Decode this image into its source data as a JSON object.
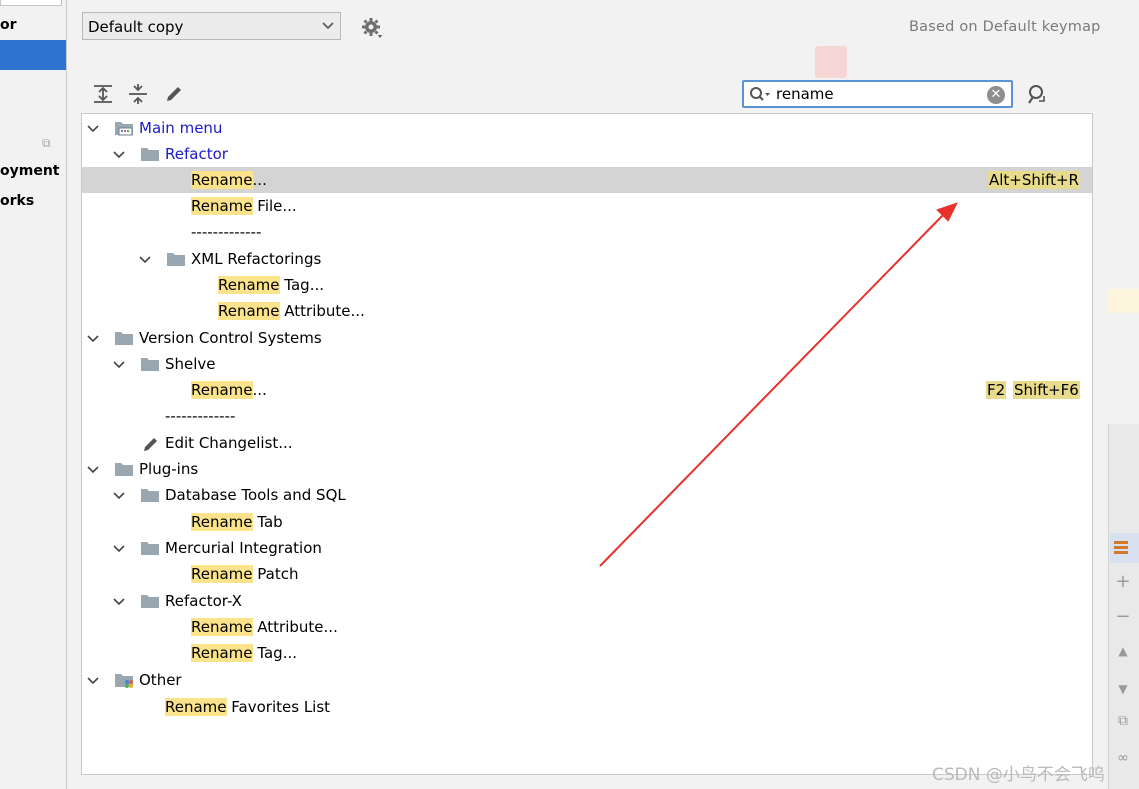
{
  "sidebar": {
    "items": [
      {
        "label": "or"
      },
      {
        "label": "oyment"
      },
      {
        "label": "orks"
      }
    ]
  },
  "keymap": {
    "selected": "Default copy",
    "based_on": "Based on Default keymap"
  },
  "search": {
    "value": "rename"
  },
  "tree": {
    "main_menu": "Main menu",
    "refactor": "Refactor",
    "rename_hl": "Rename",
    "rename_rest": "...",
    "rename_shortcut": "Alt+Shift+R",
    "rename_file_rest": " File...",
    "separator1": "-------------",
    "xml_refactorings": "XML Refactorings",
    "rename_tag_rest": " Tag...",
    "rename_attr_rest": " Attribute...",
    "vcs": "Version Control Systems",
    "shelve": "Shelve",
    "shelve_rename_rest": "...",
    "shelve_sc1": "F2",
    "shelve_sc2": "Shift+F6",
    "separator2": "-------------",
    "edit_changelist": "Edit Changelist...",
    "plugins": "Plug-ins",
    "db_tools": "Database Tools and SQL",
    "rename_tab_rest": " Tab",
    "mercurial": "Mercurial Integration",
    "rename_patch_rest": " Patch",
    "refactor_x": "Refactor-X",
    "rx_attr_rest": " Attribute...",
    "rx_tag_rest": " Tag...",
    "other": "Other",
    "favorites_rest": " Favorites List"
  },
  "watermark": "CSDN @小鸟不会飞呜",
  "colors": {
    "highlight": "#fbe38b",
    "selection": "#d4d4d4",
    "link_blue": "#1a1acc",
    "arrow": "#e8312a",
    "search_border": "#5c93d6"
  }
}
